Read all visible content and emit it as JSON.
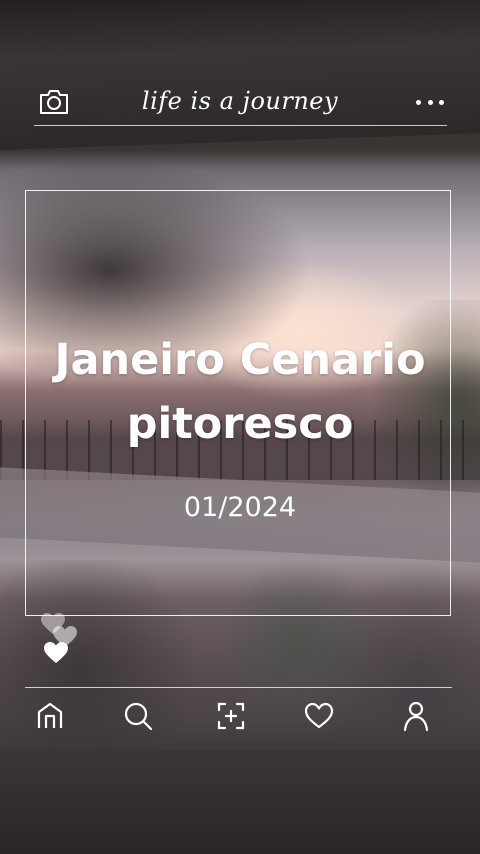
{
  "header": {
    "title": "life is a journey",
    "left_icon": "camera-icon",
    "right_icon": "more-dots-icon"
  },
  "card": {
    "headline": "Janeiro Cenario pitoresco",
    "date": "01/2024"
  },
  "reactions": {
    "icons": [
      "heart-icon",
      "heart-icon",
      "heart-icon"
    ]
  },
  "nav": {
    "items": [
      {
        "icon": "home-icon"
      },
      {
        "icon": "search-icon"
      },
      {
        "icon": "add-icon"
      },
      {
        "icon": "heart-icon"
      },
      {
        "icon": "profile-icon"
      }
    ]
  },
  "colors": {
    "foreground": "#ffffff"
  }
}
